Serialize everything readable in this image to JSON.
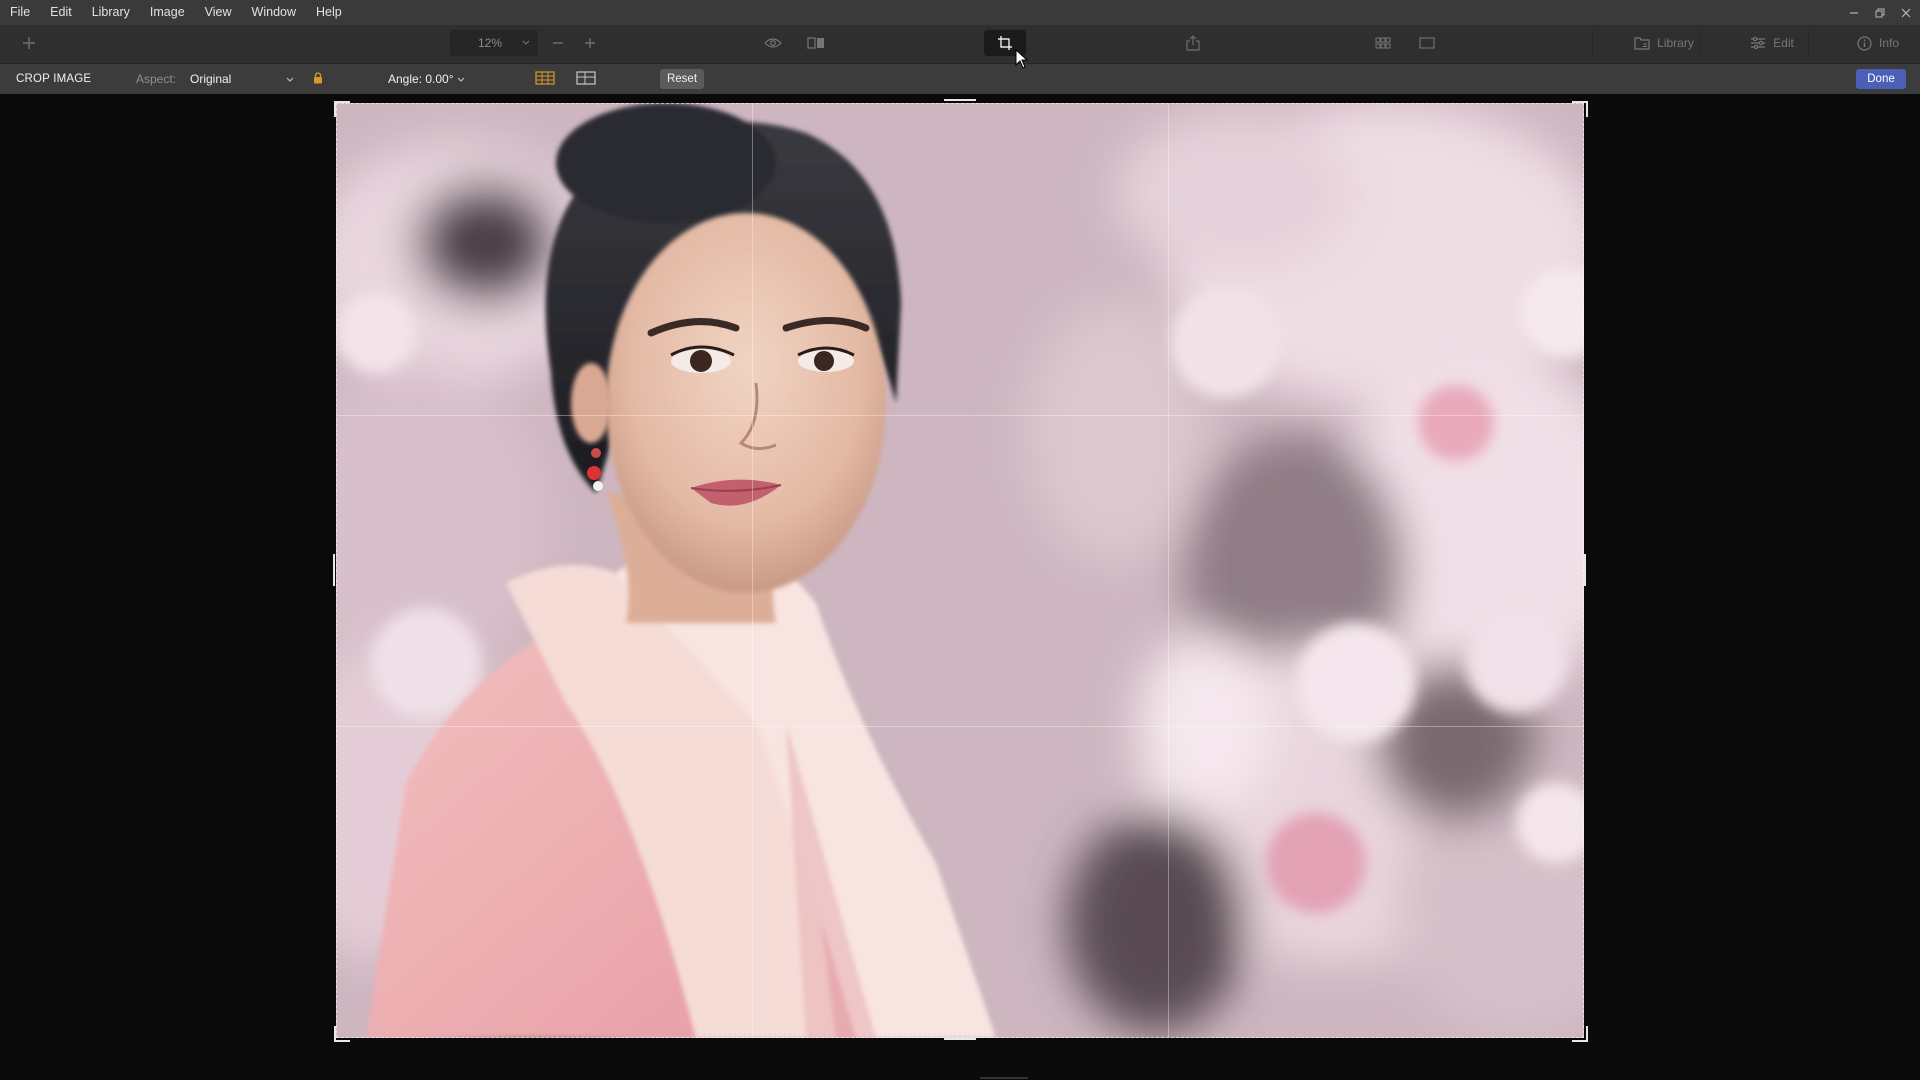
{
  "menubar": {
    "items": [
      "File",
      "Edit",
      "Library",
      "Image",
      "View",
      "Window",
      "Help"
    ]
  },
  "toolbar": {
    "zoom_value": "12%",
    "tabs": {
      "library": "Library",
      "edit": "Edit",
      "info": "Info"
    },
    "icons": [
      "plus-icon",
      "zoom-out-icon",
      "zoom-in-icon",
      "eye-icon",
      "compare-icon",
      "crop-icon",
      "share-icon",
      "grid-view-icon",
      "single-view-icon",
      "library-icon",
      "sliders-icon",
      "info-icon"
    ]
  },
  "cropbar": {
    "title": "CROP IMAGE",
    "aspect_label": "Aspect:",
    "aspect_value": "Original",
    "angle": "Angle: 0.00°",
    "reset_label": "Reset",
    "done_label": "Done"
  },
  "canvas": {
    "image_description_icon": "photo",
    "grid_overlay": "rule-of-thirds"
  },
  "colors": {
    "menubar_bg": "#3a3a3a",
    "toolbar_bg": "#2f2f2f",
    "cropbar_bg": "#3c3c3c",
    "done_button": "#4b5fb8",
    "lock_icon": "#d49a2a",
    "grid_icon": "#d49a2a"
  }
}
